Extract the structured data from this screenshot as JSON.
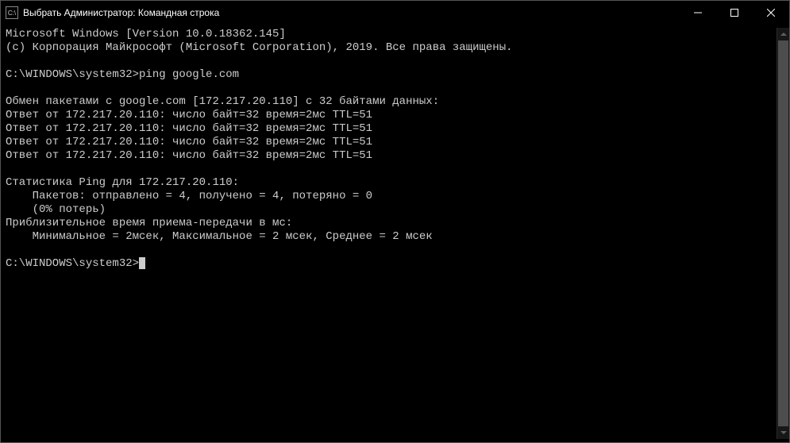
{
  "titlebar": {
    "app_icon_text": "C:\\",
    "title": "Выбрать Администратор: Командная строка"
  },
  "terminal": {
    "lines": [
      "Microsoft Windows [Version 10.0.18362.145]",
      "(c) Корпорация Майкрософт (Microsoft Corporation), 2019. Все права защищены.",
      "",
      "C:\\WINDOWS\\system32>ping google.com",
      "",
      "Обмен пакетами с google.com [172.217.20.110] с 32 байтами данных:",
      "Ответ от 172.217.20.110: число байт=32 время=2мс TTL=51",
      "Ответ от 172.217.20.110: число байт=32 время=2мс TTL=51",
      "Ответ от 172.217.20.110: число байт=32 время=2мс TTL=51",
      "Ответ от 172.217.20.110: число байт=32 время=2мс TTL=51",
      "",
      "Статистика Ping для 172.217.20.110:",
      "    Пакетов: отправлено = 4, получено = 4, потеряно = 0",
      "    (0% потерь)",
      "Приблизительное время приема-передачи в мс:",
      "    Минимальное = 2мсек, Максимальное = 2 мсек, Среднее = 2 мсек",
      ""
    ],
    "prompt": "C:\\WINDOWS\\system32>"
  }
}
